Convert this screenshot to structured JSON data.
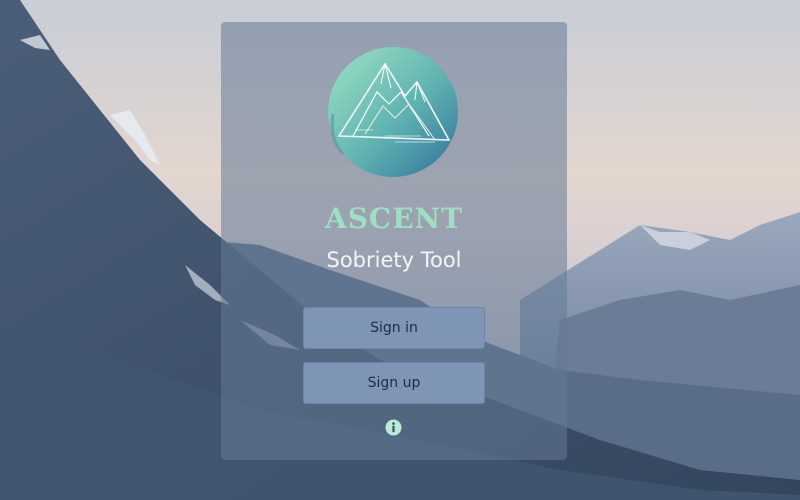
{
  "app": {
    "brand": "ASCENT",
    "subtitle": "Sobriety Tool"
  },
  "actions": {
    "sign_in_label": "Sign in",
    "sign_up_label": "Sign up"
  },
  "icons": {
    "logo": "mountain-logo-icon",
    "info": "info-icon",
    "background": "mountain-landscape"
  },
  "colors": {
    "brand_text": "#9fe0c2",
    "button_bg": "#7e95b5",
    "panel_bg": "#647a96"
  }
}
